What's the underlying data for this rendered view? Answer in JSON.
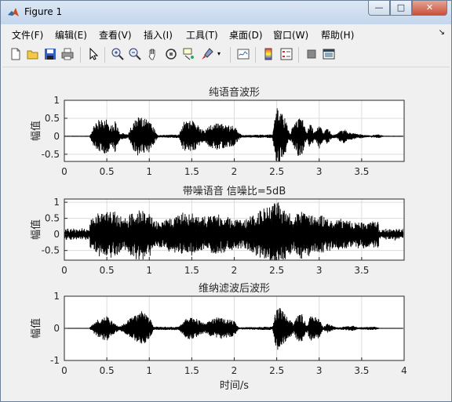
{
  "window": {
    "title": "Figure 1",
    "minimize": "—",
    "maximize": "□",
    "close": "✕"
  },
  "menu": [
    "文件(F)",
    "编辑(E)",
    "查看(V)",
    "插入(I)",
    "工具(T)",
    "桌面(D)",
    "窗口(W)",
    "帮助(H)"
  ],
  "toolbar_icons": [
    "new-figure-icon",
    "open-file-icon",
    "save-icon",
    "print-icon",
    "pointer-icon",
    "zoom-in-icon",
    "zoom-out-icon",
    "pan-hand-icon",
    "rotate-3d-icon",
    "data-cursor-icon",
    "brush-icon",
    "brush-dropdown-icon",
    "link-plot-icon",
    "colorbar-icon",
    "legend-icon",
    "hide-plot-tools-icon",
    "show-plot-tools-icon"
  ],
  "chart_data": [
    {
      "type": "line",
      "title": "纯语音波形",
      "xlabel": "",
      "ylabel": "幅值",
      "xlim": [
        0,
        4
      ],
      "ylim": [
        -0.7,
        1
      ],
      "xticks": [
        "0",
        "0.5",
        "1",
        "1.5",
        "2",
        "2.5",
        "3",
        "3.5"
      ],
      "yticks": [
        "1",
        "0.5",
        "0",
        "-0.5"
      ],
      "grid": true,
      "series": [
        {
          "envelope": [
            [
              0.3,
              0.03
            ],
            [
              0.35,
              0.3
            ],
            [
              0.4,
              0.45
            ],
            [
              0.5,
              0.5
            ],
            [
              0.55,
              0.3
            ],
            [
              0.6,
              0.45
            ],
            [
              0.65,
              0.1
            ],
            [
              0.75,
              0.05
            ],
            [
              0.8,
              0.35
            ],
            [
              0.85,
              0.55
            ],
            [
              0.92,
              0.55
            ],
            [
              1.0,
              0.45
            ],
            [
              1.05,
              0.25
            ],
            [
              1.1,
              0.03
            ],
            [
              1.35,
              0.05
            ],
            [
              1.4,
              0.4
            ],
            [
              1.5,
              0.45
            ],
            [
              1.6,
              0.25
            ],
            [
              1.65,
              0.15
            ],
            [
              1.7,
              0.3
            ],
            [
              1.8,
              0.4
            ],
            [
              1.9,
              0.3
            ],
            [
              2.0,
              0.3
            ],
            [
              2.05,
              0.1
            ],
            [
              2.1,
              0.03
            ],
            [
              2.45,
              0.05
            ],
            [
              2.5,
              0.8
            ],
            [
              2.55,
              0.65
            ],
            [
              2.6,
              0.5
            ],
            [
              2.65,
              0.1
            ],
            [
              2.7,
              0.3
            ],
            [
              2.75,
              0.55
            ],
            [
              2.8,
              0.5
            ],
            [
              2.85,
              0.1
            ],
            [
              2.9,
              0.4
            ],
            [
              2.95,
              0.1
            ],
            [
              3.0,
              0.35
            ],
            [
              3.05,
              0.1
            ],
            [
              3.1,
              0.25
            ],
            [
              3.15,
              0.05
            ],
            [
              3.2,
              0.05
            ],
            [
              3.25,
              0.15
            ],
            [
              3.3,
              0.2
            ],
            [
              3.35,
              0.12
            ],
            [
              3.4,
              0.08
            ],
            [
              3.5,
              0.05
            ],
            [
              3.55,
              0.03
            ],
            [
              3.6,
              0.02
            ],
            [
              3.7,
              0.05
            ],
            [
              3.75,
              0.02
            ]
          ]
        }
      ]
    },
    {
      "type": "line",
      "title": "带噪语音 信噪比=5dB",
      "xlabel": "",
      "ylabel": "幅值",
      "xlim": [
        0,
        4
      ],
      "ylim": [
        -0.8,
        1.1
      ],
      "xticks": [
        "0",
        "0.5",
        "1",
        "1.5",
        "2",
        "2.5",
        "3",
        "3.5"
      ],
      "yticks": [
        "1",
        "0.5",
        "0",
        "-0.5"
      ],
      "grid": true,
      "noise_level": 0.2,
      "series": [
        {
          "envelope": [
            [
              0.3,
              0.25
            ],
            [
              0.4,
              0.5
            ],
            [
              0.5,
              0.6
            ],
            [
              0.6,
              0.55
            ],
            [
              0.7,
              0.3
            ],
            [
              0.8,
              0.55
            ],
            [
              0.9,
              0.65
            ],
            [
              1.0,
              0.5
            ],
            [
              1.1,
              0.25
            ],
            [
              1.4,
              0.5
            ],
            [
              1.5,
              0.5
            ],
            [
              1.6,
              0.35
            ],
            [
              1.7,
              0.4
            ],
            [
              1.8,
              0.5
            ],
            [
              1.9,
              0.4
            ],
            [
              2.0,
              0.35
            ],
            [
              2.1,
              0.25
            ],
            [
              2.5,
              0.9
            ],
            [
              2.6,
              0.6
            ],
            [
              2.7,
              0.4
            ],
            [
              2.8,
              0.6
            ],
            [
              2.9,
              0.45
            ],
            [
              3.0,
              0.45
            ],
            [
              3.1,
              0.35
            ],
            [
              3.2,
              0.3
            ],
            [
              3.3,
              0.3
            ],
            [
              3.4,
              0.25
            ],
            [
              3.6,
              0.25
            ],
            [
              3.7,
              0.3
            ]
          ]
        }
      ]
    },
    {
      "type": "line",
      "title": "维纳滤波后波形",
      "xlabel": "时间/s",
      "ylabel": "幅值",
      "xlim": [
        0,
        4
      ],
      "ylim": [
        -1,
        1
      ],
      "xticks": [
        "0",
        "0.5",
        "1",
        "1.5",
        "2",
        "2.5",
        "3",
        "3.5",
        "4"
      ],
      "yticks": [
        "1",
        "0",
        "-1"
      ],
      "grid": true,
      "series": [
        {
          "envelope": [
            [
              0.3,
              0.03
            ],
            [
              0.4,
              0.3
            ],
            [
              0.5,
              0.4
            ],
            [
              0.55,
              0.25
            ],
            [
              0.65,
              0.05
            ],
            [
              0.8,
              0.35
            ],
            [
              0.9,
              0.55
            ],
            [
              1.0,
              0.35
            ],
            [
              1.05,
              0.05
            ],
            [
              1.35,
              0.05
            ],
            [
              1.45,
              0.35
            ],
            [
              1.55,
              0.3
            ],
            [
              1.65,
              0.15
            ],
            [
              1.8,
              0.35
            ],
            [
              1.9,
              0.3
            ],
            [
              2.0,
              0.25
            ],
            [
              2.05,
              0.03
            ],
            [
              2.45,
              0.05
            ],
            [
              2.5,
              0.75
            ],
            [
              2.6,
              0.45
            ],
            [
              2.7,
              0.15
            ],
            [
              2.75,
              0.45
            ],
            [
              2.8,
              0.45
            ],
            [
              2.85,
              0.1
            ],
            [
              2.9,
              0.4
            ],
            [
              3.0,
              0.3
            ],
            [
              3.05,
              0.05
            ],
            [
              3.1,
              0.15
            ],
            [
              3.2,
              0.03
            ],
            [
              3.4,
              0.08
            ],
            [
              3.45,
              0.03
            ],
            [
              3.65,
              0.05
            ],
            [
              3.7,
              0.02
            ]
          ]
        }
      ]
    }
  ]
}
